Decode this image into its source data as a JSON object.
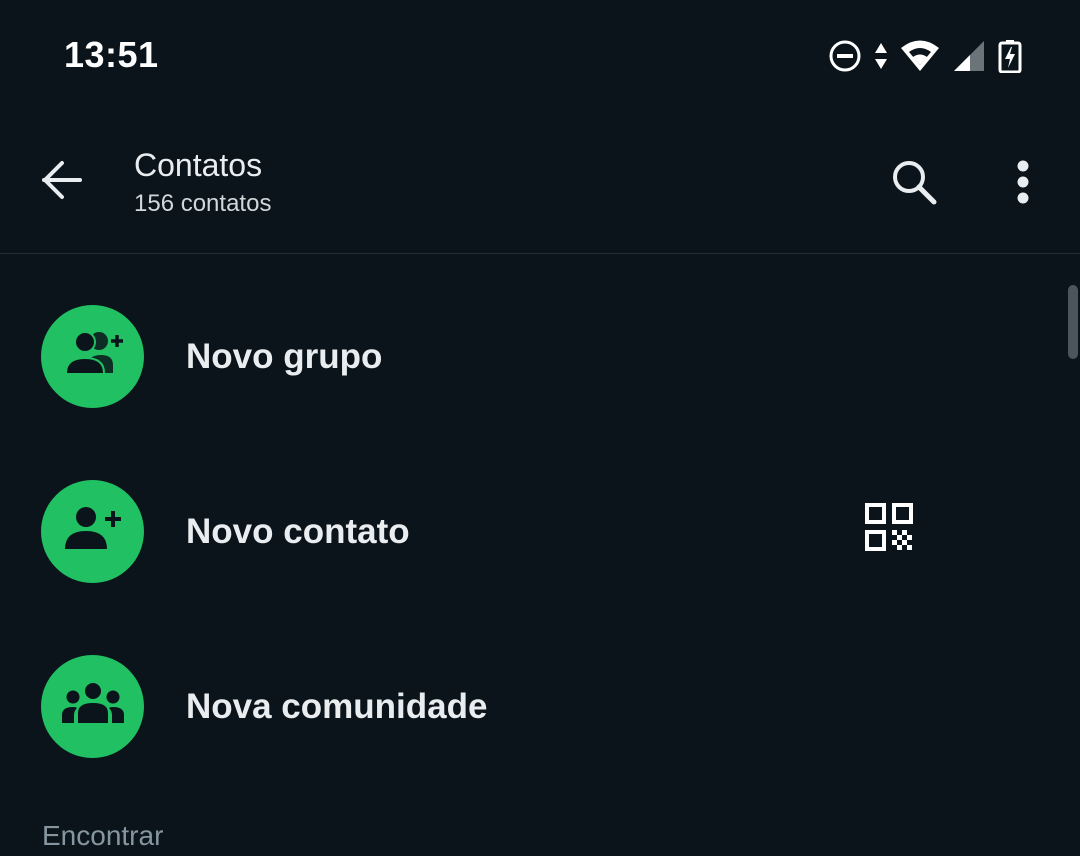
{
  "status_bar": {
    "time": "13:51",
    "icons": [
      "do-not-disturb-icon",
      "data-transfer-icon",
      "wifi-icon",
      "cell-signal-icon",
      "battery-charging-icon"
    ]
  },
  "app_bar": {
    "back_icon": "arrow-back-icon",
    "title": "Contatos",
    "subtitle": "156 contatos",
    "search_icon": "search-icon",
    "more_icon": "more-vert-icon"
  },
  "actions": [
    {
      "label": "Novo grupo",
      "icon": "group-add-icon"
    },
    {
      "label": "Novo contato",
      "icon": "person-add-icon",
      "trailing_icon": "qr-code-icon"
    },
    {
      "label": "Nova comunidade",
      "icon": "community-icon"
    }
  ],
  "section": {
    "header": "Encontrar"
  },
  "colors": {
    "background": "#0b141a",
    "accent": "#21c063",
    "text_primary": "#e9edef",
    "text_secondary": "#8696a0"
  }
}
